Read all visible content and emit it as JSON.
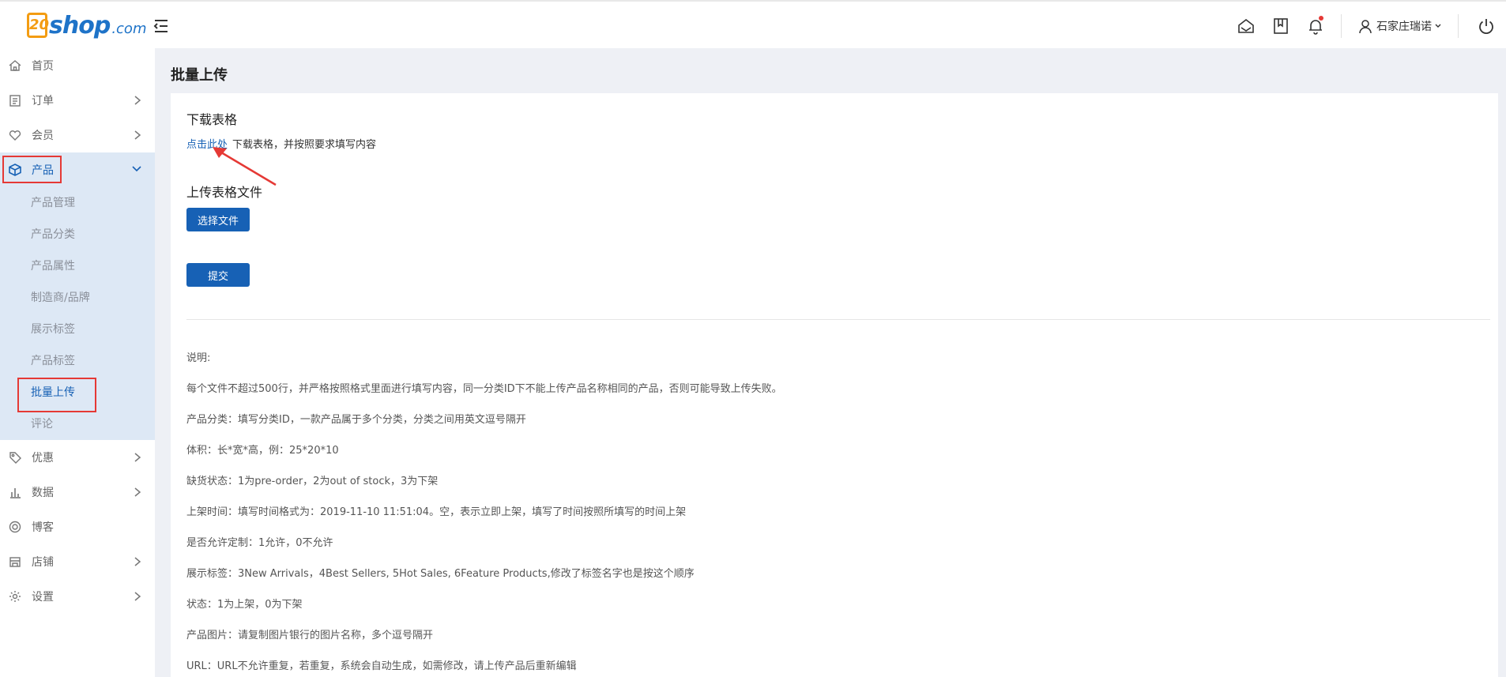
{
  "header": {
    "logo_text": "20shop.com",
    "user_name": "石家庄瑞诺"
  },
  "sidebar": {
    "items": [
      {
        "label": "首页",
        "icon": "home-icon"
      },
      {
        "label": "订单",
        "icon": "clipboard-icon"
      },
      {
        "label": "会员",
        "icon": "heart-icon"
      },
      {
        "label": "产品",
        "icon": "box-icon"
      },
      {
        "label": "优惠",
        "icon": "tag-icon"
      },
      {
        "label": "数据",
        "icon": "bar-chart-icon"
      },
      {
        "label": "博客",
        "icon": "blog-icon"
      },
      {
        "label": "店铺",
        "icon": "store-icon"
      },
      {
        "label": "设置",
        "icon": "gear-icon"
      }
    ],
    "product_sub": [
      "产品管理",
      "产品分类",
      "产品属性",
      "制造商/品牌",
      "展示标签",
      "产品标签",
      "批量上传",
      "评论"
    ]
  },
  "main": {
    "page_title": "批量上传",
    "download_heading": "下载表格",
    "download_link": "点击此处",
    "download_text": "下载表格，并按照要求填写内容",
    "upload_heading": "上传表格文件",
    "choose_file_button": "选择文件",
    "submit_button": "提交",
    "notes": [
      "说明:",
      "每个文件不超过500行，并严格按照格式里面进行填写内容，同一分类ID下不能上传产品名称相同的产品，否则可能导致上传失败。",
      "产品分类：填写分类ID，一款产品属于多个分类，分类之间用英文逗号隔开",
      "体积：长*宽*高，例：25*20*10",
      "缺货状态：1为pre-order，2为out of stock，3为下架",
      "上架时间：填写时间格式为：2019-11-10 11:51:04。空，表示立即上架，填写了时间按照所填写的时间上架",
      "是否允许定制：1允许，0不允许",
      "展示标签：3New Arrivals，4Best Sellers, 5Hot Sales, 6Feature Products,修改了标签名字也是按这个顺序",
      "状态：1为上架，0为下架",
      "产品图片：请复制图片银行的图片名称，多个逗号隔开",
      "URL：URL不允许重复，若重复，系统会自动生成，如需修改，请上传产品后重新编辑"
    ]
  },
  "colors": {
    "accent": "#1761b5",
    "highlight_box": "#e53935",
    "sidebar_group_bg": "#dde8f5"
  }
}
